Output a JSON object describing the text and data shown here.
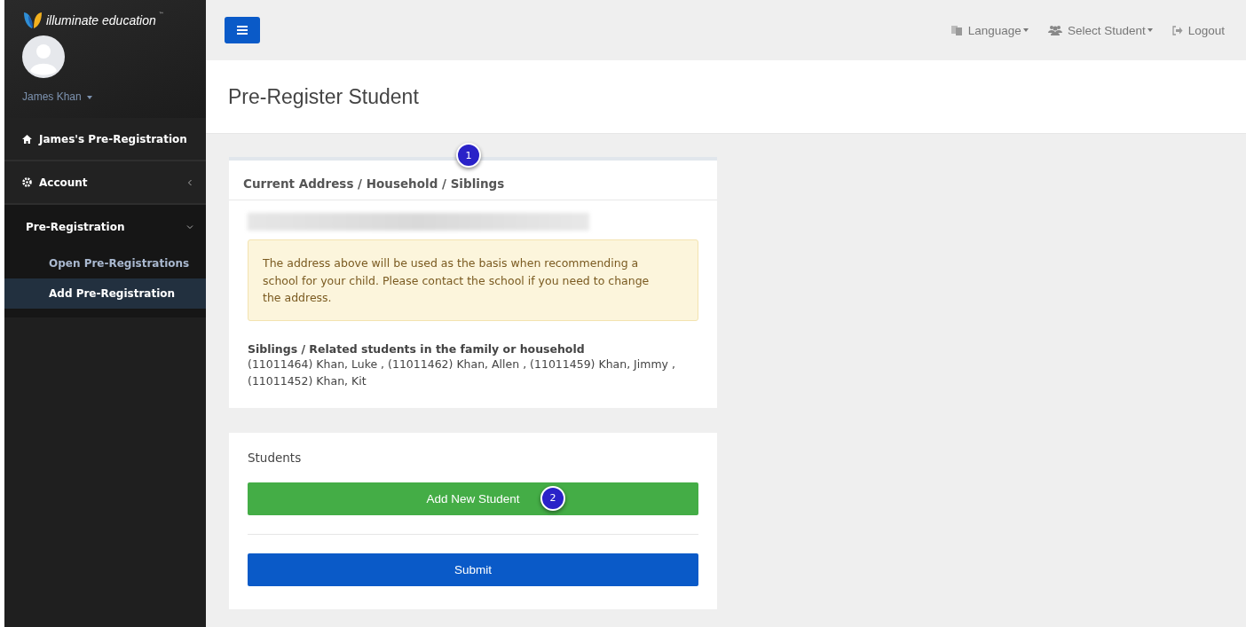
{
  "sidebar": {
    "logo_text": "illuminate education",
    "logo_mark": "™",
    "user_name": "James Khan",
    "items": [
      {
        "label": "James's Pre-Registration",
        "kind": "home",
        "selected": false
      },
      {
        "label": "Account",
        "kind": "settings",
        "selected": false,
        "expanded": false
      },
      {
        "label": "Pre-Registration",
        "kind": "group",
        "selected": false,
        "expanded": true,
        "children": [
          {
            "label": "Open Pre-Registrations",
            "selected": false
          },
          {
            "label": "Add Pre-Registration",
            "selected": true
          }
        ]
      }
    ]
  },
  "topbar": {
    "links": [
      {
        "label": "Language",
        "kind": "language",
        "dropdown": true
      },
      {
        "label": "Select Student",
        "kind": "students",
        "dropdown": true
      },
      {
        "label": "Logout",
        "kind": "logout",
        "dropdown": false
      }
    ]
  },
  "page_title": "Pre-Register Student",
  "address_panel": {
    "title": "Current Address / Household / Siblings",
    "badge": "1",
    "alert": "The address above will be used as the basis when recommending a school for your child. Please contact the school if you need to change the address.",
    "siblings_heading": "Siblings / Related students in the family or household",
    "siblings": "(11011464) Khan, Luke , (11011462) Khan, Allen , (11011459) Khan, Jimmy , (11011452) Khan, Kit"
  },
  "students_panel": {
    "title": "Students",
    "add_button": "Add New Student",
    "badge": "2",
    "submit_button": "Submit"
  }
}
